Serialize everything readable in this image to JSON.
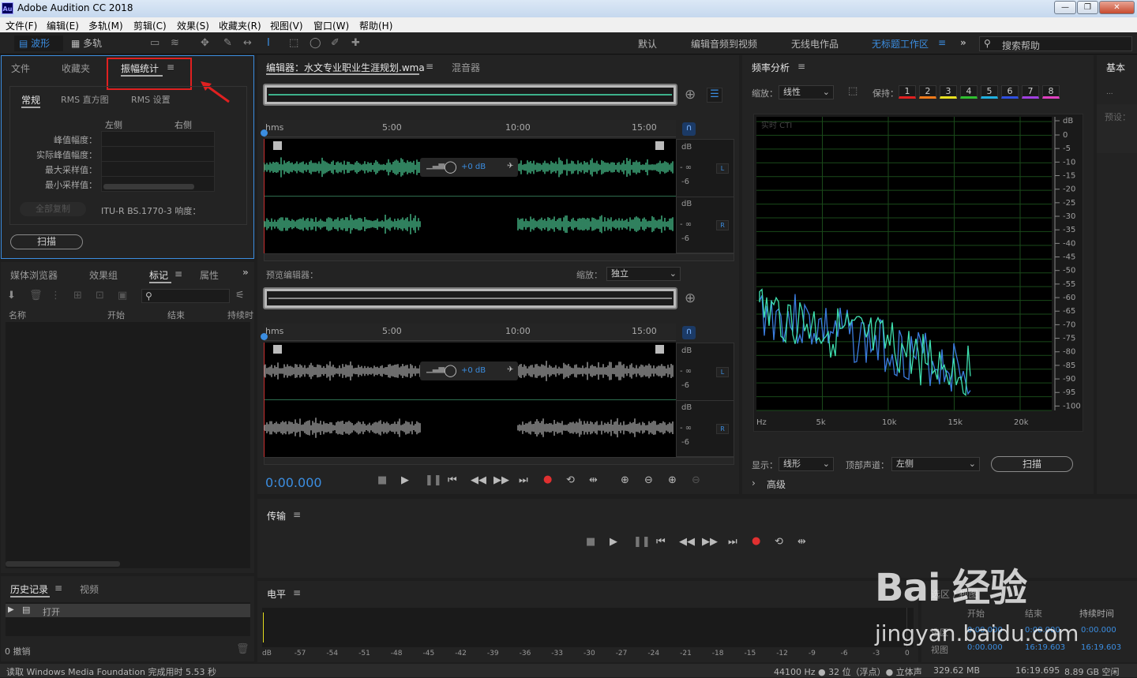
{
  "window": {
    "title": "Adobe Audition CC 2018",
    "logo": "Au",
    "min": "—",
    "max": "❐",
    "close": "✕"
  },
  "menu": [
    "文件(F)",
    "编辑(E)",
    "多轨(M)",
    "剪辑(C)",
    "效果(S)",
    "收藏夹(R)",
    "视图(V)",
    "窗口(W)",
    "帮助(H)"
  ],
  "toolbar": {
    "waveform": "波形",
    "multitrack": "多轨"
  },
  "workspaces": [
    "默认",
    "编辑音频到视频",
    "无线电作品",
    "无标题工作区"
  ],
  "search_placeholder": "搜索帮助",
  "left_panel": {
    "tabs": [
      "文件",
      "收藏夹",
      "振幅统计"
    ],
    "sub_tabs": [
      "常规",
      "RMS 直方图",
      "RMS 设置"
    ],
    "col_left": "左侧",
    "col_right": "右侧",
    "rows": [
      "峰值幅度：",
      "实际峰值幅度：",
      "最大采样值：",
      "最小采样值："
    ],
    "copy_all": "全部复制",
    "itu": "ITU-R BS.1770-3 响度：",
    "scan": "扫描"
  },
  "media_panel": {
    "tabs": [
      "媒体浏览器",
      "效果组",
      "标记",
      "属性"
    ],
    "cols": [
      "名称",
      "开始",
      "结束",
      "持续时"
    ]
  },
  "history_panel": {
    "tabs": [
      "历史记录",
      "视频"
    ],
    "item": "打开",
    "undo": "0 撤销"
  },
  "editor": {
    "tab": "编辑器：水文专业职业生涯规划.wma",
    "mixer": "混音器",
    "ruler": [
      "hms",
      "5:00",
      "10:00",
      "15:00"
    ],
    "db": "dB",
    "inf": "- ∞",
    "neg6": "-6",
    "ch_l": "L",
    "ch_r": "R",
    "hud": "+0 dB"
  },
  "preview": {
    "title": "预览编辑器：",
    "zoom_label": "缩放：",
    "zoom_value": "独立"
  },
  "time": "0:00.000",
  "freq": {
    "title": "频率分析",
    "zoom_label": "缩放：",
    "zoom_value": "线性",
    "hold_label": "保持：",
    "holds": [
      "1",
      "2",
      "3",
      "4",
      "5",
      "6",
      "7",
      "8"
    ],
    "hold_colors": [
      "#e02020",
      "#f07a1a",
      "#e8e020",
      "#30c030",
      "#20b0e0",
      "#3050e0",
      "#a040e0",
      "#e040c0"
    ],
    "realtime": "实时 CTI",
    "y_ticks": [
      "dB",
      "0",
      "-5",
      "-10",
      "-15",
      "-20",
      "-25",
      "-30",
      "-35",
      "-40",
      "-45",
      "-50",
      "-55",
      "-60",
      "-65",
      "-70",
      "-75",
      "-80",
      "-85",
      "-90",
      "-95",
      "-100"
    ],
    "x_ticks": [
      "Hz",
      "5k",
      "10k",
      "15k",
      "20k"
    ],
    "display_label": "显示：",
    "display_value": "线形",
    "channel_label": "顶部声道：",
    "channel_value": "左侧",
    "scan": "扫描",
    "advanced": "高级"
  },
  "right_panel": {
    "tab": "基本",
    "preset": "预设："
  },
  "transport_panel": {
    "title": "传输"
  },
  "level_panel": {
    "title": "电平",
    "scale": [
      "dB",
      "-57",
      "-54",
      "-51",
      "-48",
      "-45",
      "-42",
      "-39",
      "-36",
      "-33",
      "-30",
      "-27",
      "-24",
      "-21",
      "-18",
      "-15",
      "-12",
      "-9",
      "-6",
      "-3",
      "0"
    ]
  },
  "selection_panel": {
    "title": "选区 / 视图",
    "cols": [
      "开始",
      "结束",
      "持续时间"
    ],
    "rows": [
      {
        "label": "选区",
        "start": "0:00.000",
        "end": "0:00.000",
        "dur": "0:00.000"
      },
      {
        "label": "视图",
        "start": "0:00.000",
        "end": "16:19.603",
        "dur": "16:19.603"
      }
    ]
  },
  "status": {
    "left": "读取 Windows Media Foundation 完成用时 5.53 秒",
    "rate": "44100 Hz ● 32 位（浮点）● 立体声",
    "size": "329.62 MB",
    "duration": "16:19.695",
    "free": "8.89 GB 空闲"
  },
  "watermark": {
    "brand": "Bai 经验",
    "url": "jingyan.baidu.com"
  }
}
